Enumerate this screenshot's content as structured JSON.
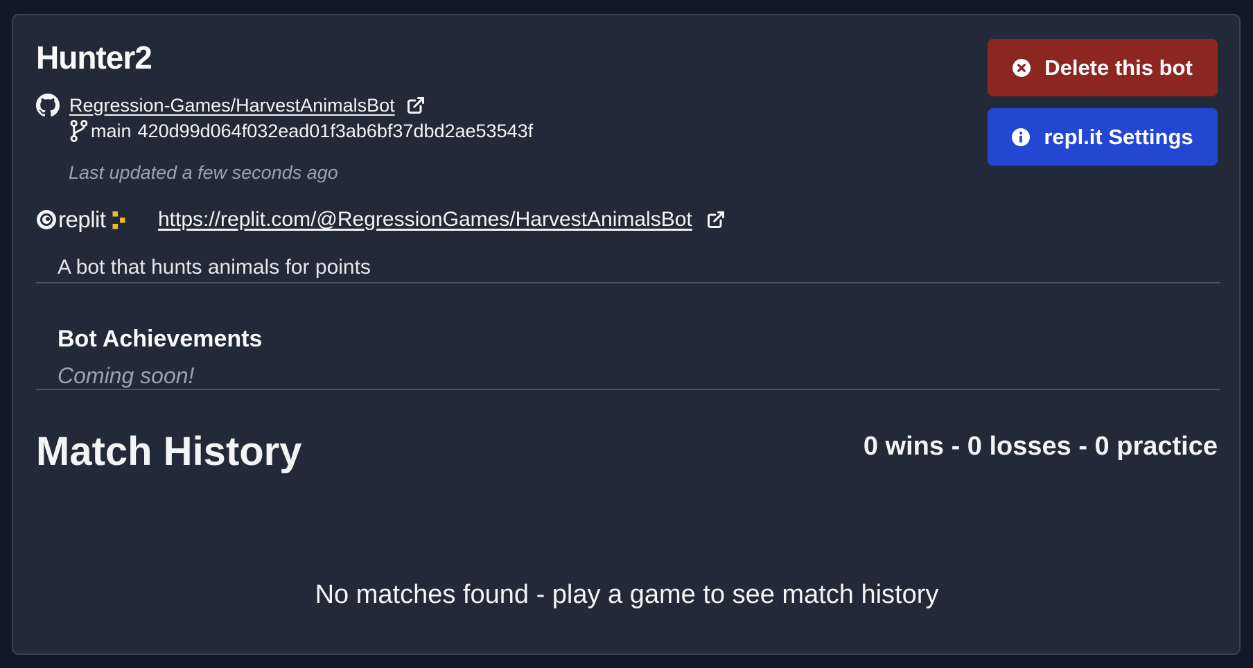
{
  "bot": {
    "name": "Hunter2",
    "repo_label": "Regression-Games/HarvestAnimalsBot",
    "branch": "main",
    "commit": "420d99d064f032ead01f3ab6bf37dbd2ae53543f",
    "last_updated": "Last updated a few seconds ago",
    "replit_logo_text": "replit",
    "replit_url": "https://replit.com/@RegressionGames/HarvestAnimalsBot",
    "description": "A bot that hunts animals for points"
  },
  "actions": {
    "delete_label": "Delete this bot",
    "settings_label": "repl.it Settings"
  },
  "achievements": {
    "title": "Bot Achievements",
    "status": "Coming soon!"
  },
  "match_history": {
    "title": "Match History",
    "record": "0 wins - 0 losses - 0 practice",
    "empty_message": "No matches found - play a game to see match history"
  },
  "colors": {
    "page_bg": "#111827",
    "card_bg": "#222938",
    "delete_button": "#8b2621",
    "settings_button": "#2347d3",
    "replit_accent": "#f5b52d"
  },
  "icons": {
    "repo": "github-icon",
    "external": "external-link-icon",
    "branch": "git-branch-icon",
    "delete": "circle-x-icon",
    "settings": "info-circle-icon"
  }
}
